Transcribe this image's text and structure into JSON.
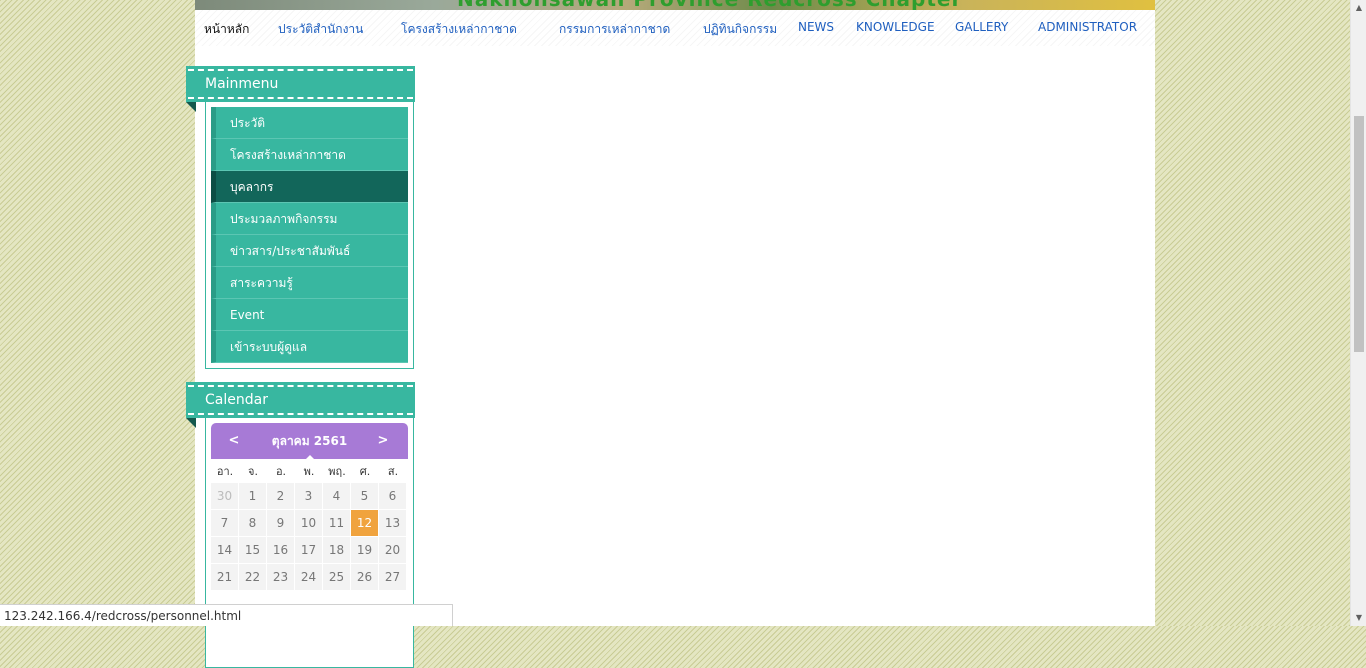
{
  "banner": {
    "text": "Nakhonsawan Province Redcross Chapter"
  },
  "topnav": {
    "items": [
      {
        "label": "หน้าหลัก"
      },
      {
        "label": "ประวัติสำนักงาน"
      },
      {
        "label": "โครงสร้างเหล่ากาชาด"
      },
      {
        "label": "กรรมการเหล่ากาชาด"
      },
      {
        "label": "ปฏิทินกิจกรรม"
      },
      {
        "label": "NEWS"
      },
      {
        "label": "KNOWLEDGE"
      },
      {
        "label": "GALLERY"
      },
      {
        "label": "ADMINISTRATOR"
      }
    ],
    "active_index": 0
  },
  "mainmenu": {
    "title": "Mainmenu",
    "items": [
      {
        "label": "ประวัติ"
      },
      {
        "label": "โครงสร้างเหล่ากาชาด"
      },
      {
        "label": "บุคลากร"
      },
      {
        "label": "ประมวลภาพกิจกรรม"
      },
      {
        "label": "ข่าวสาร/ประชาสัมพันธ์"
      },
      {
        "label": "สาระความรู้"
      },
      {
        "label": "Event"
      },
      {
        "label": "เข้าระบบผู้ดูแล"
      }
    ],
    "active_index": 2
  },
  "calendar": {
    "title": "Calendar",
    "month_label": "ตุลาคม 2561",
    "prev_label": "<",
    "next_label": ">",
    "weekdays": [
      "อา.",
      "จ.",
      "อ.",
      "พ.",
      "พฤ.",
      "ศ.",
      "ส."
    ],
    "weeks": [
      [
        "30",
        "1",
        "2",
        "3",
        "4",
        "5",
        "6"
      ],
      [
        "7",
        "8",
        "9",
        "10",
        "11",
        "12",
        "13"
      ],
      [
        "14",
        "15",
        "16",
        "17",
        "18",
        "19",
        "20"
      ],
      [
        "21",
        "22",
        "23",
        "24",
        "25",
        "26",
        "27"
      ]
    ],
    "other_month_days": [
      "30"
    ],
    "today": "12"
  },
  "statusbar": {
    "url": "123.242.166.4/redcross/personnel.html"
  },
  "colors": {
    "teal": "#38b7a0",
    "teal_dark": "#12665a",
    "calendar_header": "#a77ad6",
    "today": "#f0a33e",
    "nav_link": "#1f5fbf"
  }
}
